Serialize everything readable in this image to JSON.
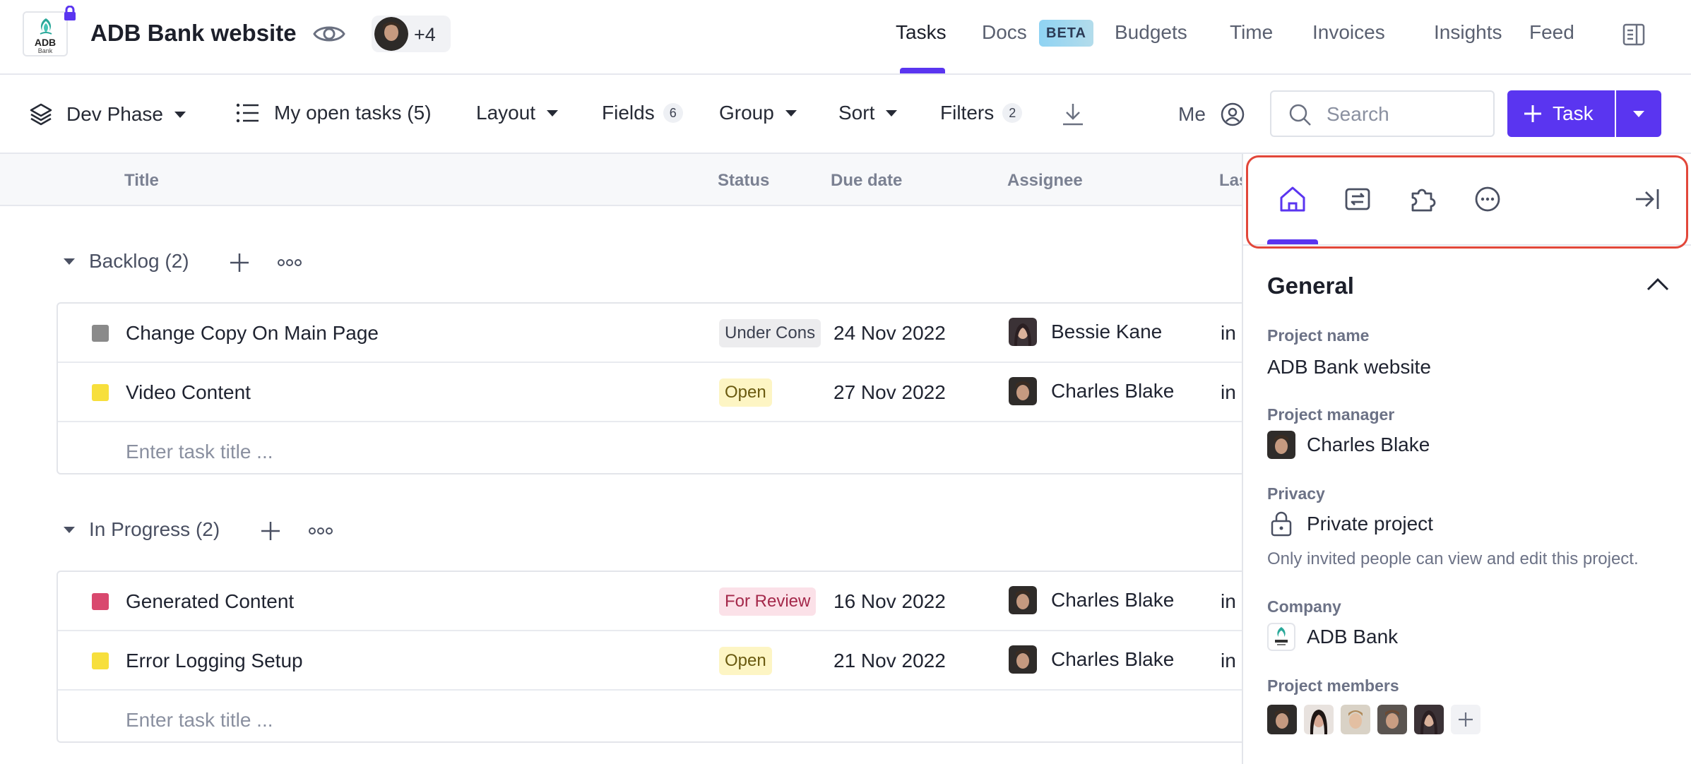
{
  "header": {
    "project_title": "ADB Bank website",
    "logo_name": "ADB",
    "logo_sub": "Bank",
    "members_extra": "+4",
    "tabs": [
      {
        "label": "Tasks",
        "active": true
      },
      {
        "label": "Docs",
        "badge": "BETA"
      },
      {
        "label": "Budgets"
      },
      {
        "label": "Time"
      },
      {
        "label": "Invoices"
      },
      {
        "label": "Insights"
      },
      {
        "label": "Feed"
      }
    ],
    "accent_color": "#5a35f0"
  },
  "toolbar": {
    "phase": "Dev Phase",
    "view": "My open tasks (5)",
    "layout": "Layout",
    "fields": "Fields",
    "fields_count": "6",
    "group": "Group",
    "sort": "Sort",
    "filters": "Filters",
    "filters_count": "2",
    "me": "Me",
    "search_placeholder": "Search",
    "task_button": "Task"
  },
  "table": {
    "columns": [
      "Title",
      "Status",
      "Due date",
      "Assignee",
      "Las"
    ],
    "task_placeholder": "Enter task title ...",
    "groups": [
      {
        "name": "Backlog (2)",
        "rows": [
          {
            "color": "#8a8a8a",
            "title": "Change Copy On Main Page",
            "status": "Under Cons",
            "status_bg": "#ececee",
            "status_fg": "#3c4150",
            "due": "24 Nov 2022",
            "assignee": "Bessie Kane",
            "last": "in"
          },
          {
            "color": "#f7df3c",
            "title": "Video Content",
            "status": "Open",
            "status_bg": "#fdf5c4",
            "status_fg": "#6a5a10",
            "due": "27 Nov 2022",
            "assignee": "Charles Blake",
            "last": "in"
          }
        ]
      },
      {
        "name": "In Progress (2)",
        "rows": [
          {
            "color": "#d9486e",
            "title": "Generated Content",
            "status": "For Review",
            "status_bg": "#fbe1e8",
            "status_fg": "#a4284a",
            "due": "16 Nov 2022",
            "assignee": "Charles Blake",
            "last": "in"
          },
          {
            "color": "#f7df3c",
            "title": "Error Logging Setup",
            "status": "Open",
            "status_bg": "#fdf5c4",
            "status_fg": "#6a5a10",
            "due": "21 Nov 2022",
            "assignee": "Charles Blake",
            "last": "in"
          }
        ]
      }
    ]
  },
  "panel": {
    "section_title": "General",
    "project_name_label": "Project name",
    "project_name": "ADB Bank website",
    "manager_label": "Project manager",
    "manager": "Charles Blake",
    "privacy_label": "Privacy",
    "privacy": "Private project",
    "privacy_note": "Only invited people can view and edit this project.",
    "company_label": "Company",
    "company": "ADB Bank",
    "members_label": "Project members"
  }
}
